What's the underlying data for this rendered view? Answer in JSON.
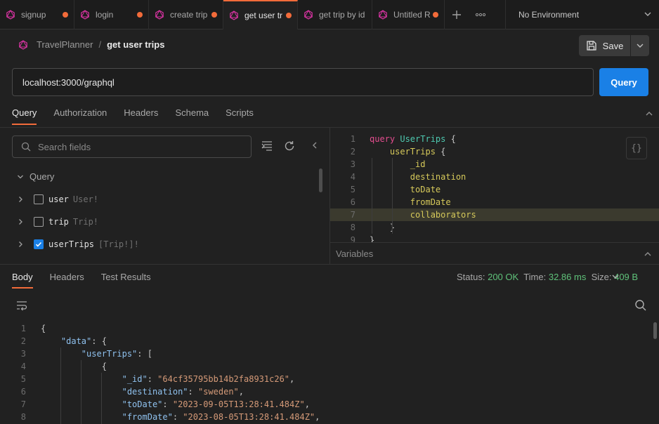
{
  "colors": {
    "accent": "#f26b3a",
    "primary": "#1a80e6",
    "graphql_pink": "#e535ab",
    "status_green": "#5fc27a"
  },
  "tabs": [
    {
      "label": "signup",
      "icon": "graphql-icon",
      "unsaved": true,
      "active": false
    },
    {
      "label": "login",
      "icon": "graphql-icon",
      "unsaved": true,
      "active": false
    },
    {
      "label": "create trip",
      "icon": "graphql-icon",
      "unsaved": true,
      "active": false
    },
    {
      "label": "get user tr",
      "icon": "graphql-icon",
      "unsaved": true,
      "active": true
    },
    {
      "label": "get trip by id",
      "icon": "graphql-icon",
      "unsaved": false,
      "active": false
    },
    {
      "label": "Untitled R",
      "icon": "graphql-icon",
      "unsaved": true,
      "active": false
    }
  ],
  "environment": {
    "label": "No Environment"
  },
  "breadcrumb": {
    "collection": "TravelPlanner",
    "separator": "/",
    "request": "get user trips"
  },
  "toolbar": {
    "save_label": "Save"
  },
  "url": {
    "value": "localhost:3000/graphql",
    "send_label": "Query"
  },
  "request_tabs": [
    "Query",
    "Authorization",
    "Headers",
    "Schema",
    "Scripts"
  ],
  "explorer": {
    "search_placeholder": "Search fields",
    "section": "Query",
    "fields": [
      {
        "name": "user",
        "type": "User!",
        "checked": false
      },
      {
        "name": "trip",
        "type": "Trip!",
        "checked": false
      },
      {
        "name": "userTrips",
        "type": "[Trip!]!",
        "checked": true
      }
    ]
  },
  "editor": {
    "format_label": "{}",
    "lines": [
      {
        "n": "1",
        "parts": [
          [
            "kw",
            "query"
          ],
          [
            "txt",
            " "
          ],
          [
            "op",
            "UserTrips"
          ],
          [
            "txt",
            " {"
          ]
        ]
      },
      {
        "n": "2",
        "parts": [
          [
            "txt",
            "    "
          ],
          [
            "fld",
            "userTrips"
          ],
          [
            "txt",
            " {"
          ]
        ]
      },
      {
        "n": "3",
        "parts": [
          [
            "txt",
            "        "
          ],
          [
            "fld",
            "_id"
          ]
        ]
      },
      {
        "n": "4",
        "parts": [
          [
            "txt",
            "        "
          ],
          [
            "fld",
            "destination"
          ]
        ]
      },
      {
        "n": "5",
        "parts": [
          [
            "txt",
            "        "
          ],
          [
            "fld",
            "toDate"
          ]
        ]
      },
      {
        "n": "6",
        "parts": [
          [
            "txt",
            "        "
          ],
          [
            "fld",
            "fromDate"
          ]
        ]
      },
      {
        "n": "7",
        "parts": [
          [
            "txt",
            "        "
          ],
          [
            "fld",
            "collaborators"
          ]
        ],
        "highlight": true
      },
      {
        "n": "8",
        "parts": [
          [
            "txt",
            "    }"
          ]
        ]
      },
      {
        "n": "9",
        "parts": [
          [
            "txt",
            "}"
          ]
        ]
      }
    ],
    "variables_label": "Variables"
  },
  "response": {
    "tabs": [
      "Body",
      "Headers",
      "Test Results"
    ],
    "status_label": "Status:",
    "status_value": "200 OK",
    "time_label": "Time:",
    "time_value": "32.86 ms",
    "size_label": "Size:",
    "size_value": "409 B",
    "lines": [
      {
        "n": "1",
        "parts": [
          [
            "punc",
            "{"
          ]
        ]
      },
      {
        "n": "2",
        "parts": [
          [
            "punc",
            "    "
          ],
          [
            "key",
            "\"data\""
          ],
          [
            "punc",
            ": {"
          ]
        ]
      },
      {
        "n": "3",
        "parts": [
          [
            "punc",
            "        "
          ],
          [
            "key",
            "\"userTrips\""
          ],
          [
            "punc",
            ": ["
          ]
        ]
      },
      {
        "n": "4",
        "parts": [
          [
            "punc",
            "            {"
          ]
        ]
      },
      {
        "n": "5",
        "parts": [
          [
            "punc",
            "                "
          ],
          [
            "key",
            "\"_id\""
          ],
          [
            "punc",
            ": "
          ],
          [
            "str",
            "\"64cf35795bb14b2fa8931c26\""
          ],
          [
            "punc",
            ","
          ]
        ]
      },
      {
        "n": "6",
        "parts": [
          [
            "punc",
            "                "
          ],
          [
            "key",
            "\"destination\""
          ],
          [
            "punc",
            ": "
          ],
          [
            "str",
            "\"sweden\""
          ],
          [
            "punc",
            ","
          ]
        ]
      },
      {
        "n": "7",
        "parts": [
          [
            "punc",
            "                "
          ],
          [
            "key",
            "\"toDate\""
          ],
          [
            "punc",
            ": "
          ],
          [
            "str",
            "\"2023-09-05T13:28:41.484Z\""
          ],
          [
            "punc",
            ","
          ]
        ]
      },
      {
        "n": "8",
        "parts": [
          [
            "punc",
            "                "
          ],
          [
            "key",
            "\"fromDate\""
          ],
          [
            "punc",
            ": "
          ],
          [
            "str",
            "\"2023-08-05T13:28:41.484Z\""
          ],
          [
            "punc",
            ","
          ]
        ]
      }
    ]
  }
}
